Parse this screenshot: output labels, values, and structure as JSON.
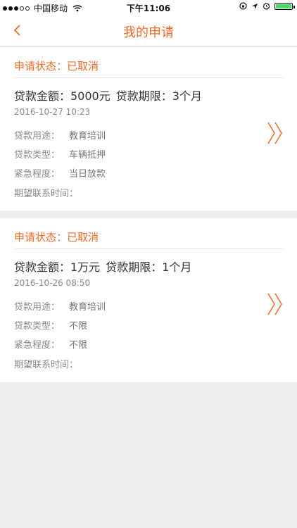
{
  "status_bar": {
    "carrier": "中国移动",
    "time": "下午11:06"
  },
  "header": {
    "title": "我的申请"
  },
  "colors": {
    "accent": "#ef6a26",
    "battery": "#4cd964"
  },
  "applications": [
    {
      "status": "申请状态：已取消",
      "amount": "贷款金额：5000元",
      "term": "贷款期限：3个月",
      "date": "2016-10-27 10:23",
      "details": [
        {
          "label": "贷款用途：",
          "value": "教育培训"
        },
        {
          "label": "贷款类型：",
          "value": "车辆抵押"
        },
        {
          "label": "紧急程度：",
          "value": "当日放款"
        },
        {
          "label": "期望联系时间：",
          "value": ""
        }
      ]
    },
    {
      "status": "申请状态：已取消",
      "amount": "贷款金额：1万元",
      "term": "贷款期限：1个月",
      "date": "2016-10-26 08:50",
      "details": [
        {
          "label": "贷款用途：",
          "value": "教育培训"
        },
        {
          "label": "贷款类型：",
          "value": "不限"
        },
        {
          "label": "紧急程度：",
          "value": "不限"
        },
        {
          "label": "期望联系时间：",
          "value": ""
        }
      ]
    }
  ]
}
